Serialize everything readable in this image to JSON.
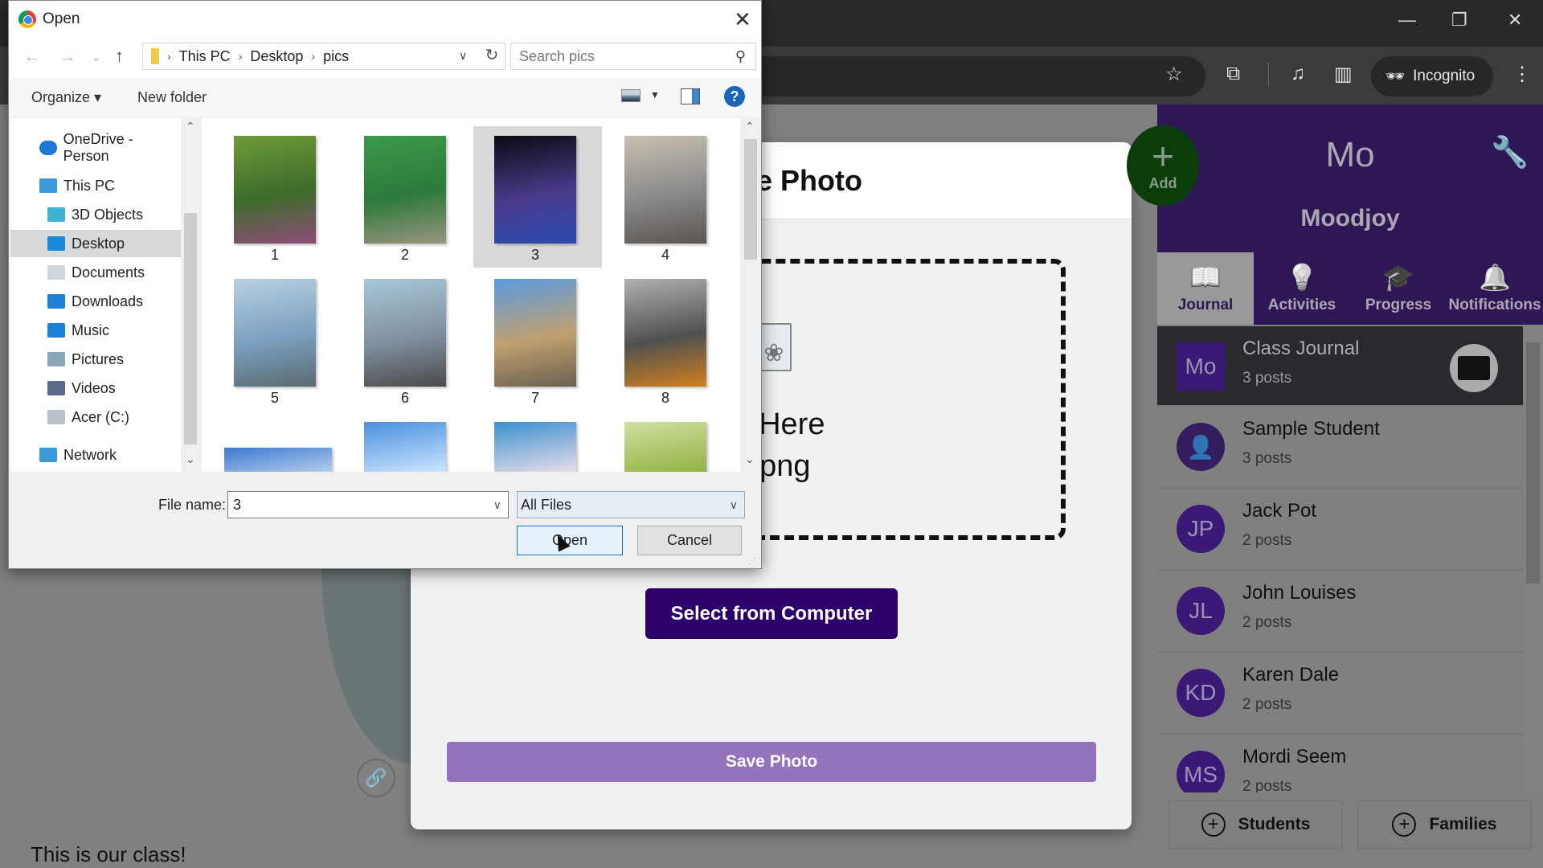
{
  "browser": {
    "window_controls": {
      "minimize": "—",
      "restore": "❐",
      "close": "✕"
    },
    "toolbar_icons": [
      "star-icon",
      "extensions-icon",
      "media-icon",
      "side-panel-icon"
    ],
    "incognito_label": "Incognito",
    "menu_icon": "⋮"
  },
  "file_dialog": {
    "title": "Open",
    "close": "✕",
    "nav": {
      "back": "←",
      "forward": "→",
      "recent": "⌄",
      "up": "↑"
    },
    "breadcrumb": [
      "This PC",
      "Desktop",
      "pics"
    ],
    "refresh": "↻",
    "search_placeholder": "Search pics",
    "toolbar": {
      "organize": "Organize ▾",
      "new_folder": "New folder",
      "help": "?"
    },
    "nav_pane": [
      {
        "label": "OneDrive - Person",
        "icon": "onedrive-icon",
        "level": 0,
        "selected": false
      },
      {
        "label": "This PC",
        "icon": "computer-icon",
        "level": 0,
        "selected": false
      },
      {
        "label": "3D Objects",
        "icon": "3d-objects-icon",
        "level": 1,
        "selected": false
      },
      {
        "label": "Desktop",
        "icon": "desktop-icon",
        "level": 1,
        "selected": true
      },
      {
        "label": "Documents",
        "icon": "documents-icon",
        "level": 1,
        "selected": false
      },
      {
        "label": "Downloads",
        "icon": "downloads-icon",
        "level": 1,
        "selected": false
      },
      {
        "label": "Music",
        "icon": "music-icon",
        "level": 1,
        "selected": false
      },
      {
        "label": "Pictures",
        "icon": "pictures-icon",
        "level": 1,
        "selected": false
      },
      {
        "label": "Videos",
        "icon": "videos-icon",
        "level": 1,
        "selected": false
      },
      {
        "label": "Acer (C:)",
        "icon": "drive-icon",
        "level": 1,
        "selected": false
      },
      {
        "label": "Network",
        "icon": "network-icon",
        "level": 0,
        "selected": false
      }
    ],
    "files": [
      {
        "name": "1",
        "selected": false,
        "colors": [
          "#6f9a3a",
          "#3d6b2a",
          "#8e4d7a"
        ]
      },
      {
        "name": "2",
        "selected": false,
        "colors": [
          "#3a9a4a",
          "#2d7a3a",
          "#9a9480"
        ]
      },
      {
        "name": "3",
        "selected": true,
        "colors": [
          "#0a0a12",
          "#4a3a8a",
          "#2a4ab0"
        ]
      },
      {
        "name": "4",
        "selected": false,
        "colors": [
          "#c8c0b0",
          "#8a8a8a",
          "#5a5550"
        ]
      },
      {
        "name": "5",
        "selected": false,
        "colors": [
          "#b8d0e0",
          "#7aa0c0",
          "#5a6a70"
        ]
      },
      {
        "name": "6",
        "selected": false,
        "colors": [
          "#a8c8d8",
          "#8090a0",
          "#4a4a4a"
        ]
      },
      {
        "name": "7",
        "selected": false,
        "colors": [
          "#5a9ae0",
          "#c0a070",
          "#6a6050"
        ]
      },
      {
        "name": "8",
        "selected": false,
        "colors": [
          "#b0b0b0",
          "#505050",
          "#d08020"
        ]
      },
      {
        "name": "",
        "selected": false,
        "colors": [
          "#3a7ad0",
          "#ffffff",
          "#a0c8f0"
        ]
      },
      {
        "name": "",
        "selected": false,
        "colors": [
          "#4a90e0",
          "#d0e8ff",
          "#8ab8e8"
        ]
      },
      {
        "name": "",
        "selected": false,
        "colors": [
          "#3a90d0",
          "#f0e0e8",
          "#5a3a2a"
        ]
      },
      {
        "name": "",
        "selected": false,
        "colors": [
          "#d0e0a0",
          "#90b040",
          "#c0c8d0"
        ]
      }
    ],
    "file_name_label": "File name:",
    "file_name_value": "3",
    "file_type": "All Files",
    "open_label": "Open",
    "cancel_label": "Cancel"
  },
  "page": {
    "caption": "This is our class!",
    "link_icon": "🔗"
  },
  "modal": {
    "title": "Profile Photo",
    "drop_text_line1": "ile Here",
    "drop_text_line2": ", .png",
    "select_button": "Select from Computer",
    "save_button": "Save Photo"
  },
  "right_panel": {
    "initial": "Mo",
    "name": "Moodjoy",
    "add_label": "Add",
    "tabs": [
      {
        "label": "Journal",
        "icon": "📖",
        "active": true
      },
      {
        "label": "Activities",
        "icon": "💡",
        "active": false
      },
      {
        "label": "Progress",
        "icon": "🎓",
        "active": false
      },
      {
        "label": "Notifications",
        "icon": "🔔",
        "active": false
      }
    ],
    "list": [
      {
        "avatar": "Mo",
        "name": "Class Journal",
        "posts": "3 posts"
      },
      {
        "avatar": "👤",
        "name": "Sample Student",
        "posts": "3 posts"
      },
      {
        "avatar": "JP",
        "name": "Jack Pot",
        "posts": "2 posts"
      },
      {
        "avatar": "JL",
        "name": "John Louises",
        "posts": "2 posts"
      },
      {
        "avatar": "KD",
        "name": "Karen Dale",
        "posts": "2 posts"
      },
      {
        "avatar": "MS",
        "name": "Mordi Seem",
        "posts": "2 posts"
      }
    ],
    "footer": [
      {
        "label": "Students"
      },
      {
        "label": "Families"
      }
    ]
  }
}
